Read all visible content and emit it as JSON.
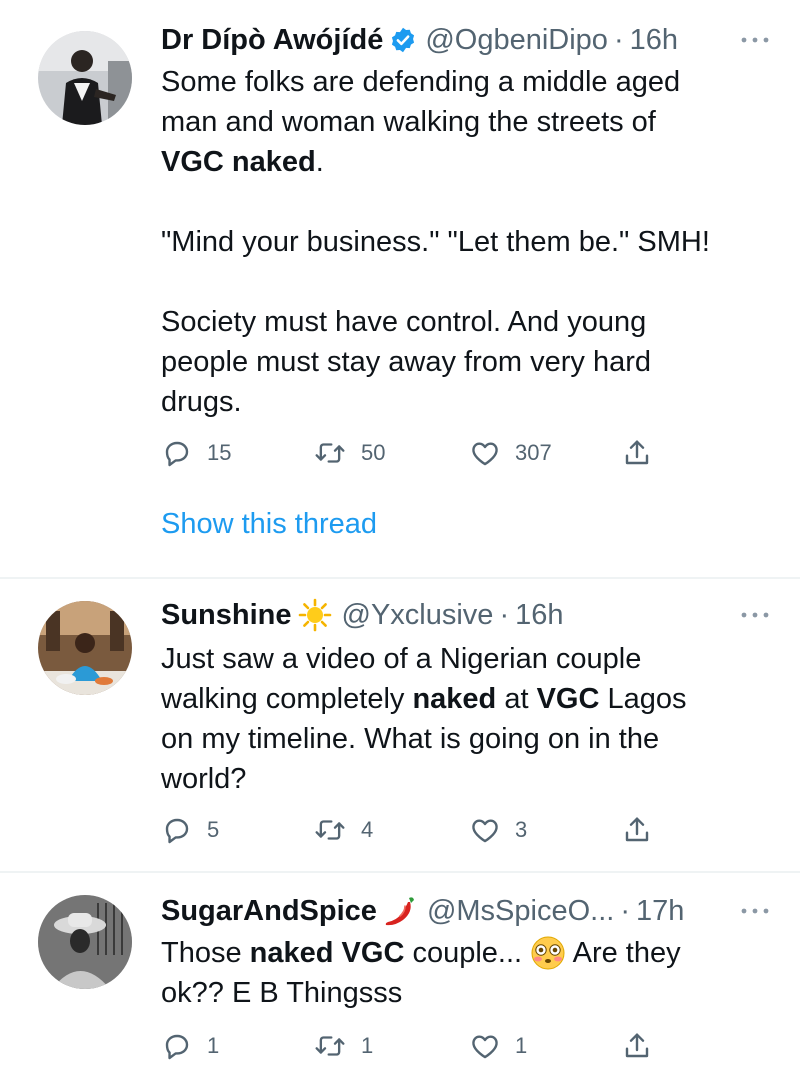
{
  "tweets": [
    {
      "display_name": "Dr Dípò Awójídé",
      "verified": true,
      "handle": "@OgbeniDipo",
      "time": "16h",
      "body": {
        "l1": "Some folks are defending a middle aged",
        "l2": "man and woman walking the streets of",
        "l3_bold": "VGC naked",
        "l3_end": ".",
        "l4": "\"Mind your business.\" \"Let them be.\" SMH!",
        "l5": "Society must have control. And young",
        "l6": "people must stay away from very hard",
        "l7": "drugs."
      },
      "replies": "15",
      "retweets": "50",
      "likes": "307",
      "show_thread": "Show this thread"
    },
    {
      "display_name": "Sunshine",
      "name_emoji": "sun-emoji",
      "handle": "@Yxclusive",
      "time": "16h",
      "body": {
        "l1": "Just saw a video of a Nigerian couple",
        "l2_a": "walking completely ",
        "l2_b": "naked",
        "l2_c": " at ",
        "l2_d": "VGC",
        "l2_e": " Lagos",
        "l3": "on my timeline. What is going on in the",
        "l4": "world?"
      },
      "replies": "5",
      "retweets": "4",
      "likes": "3"
    },
    {
      "display_name": "SugarAndSpice",
      "name_emoji": "hot-pepper-emoji",
      "handle": "@MsSpiceO...",
      "time": "17h",
      "body": {
        "l1_a": "Those ",
        "l1_b": "naked VGC",
        "l1_c": " couple... ",
        "l1_d": " Are they",
        "l2": "ok?? E B Thingsss"
      },
      "inline_emoji": "flushed-face-emoji",
      "replies": "1",
      "retweets": "1",
      "likes": "1"
    }
  ],
  "colors": {
    "primary_text": "#0f1419",
    "secondary_text": "#536471",
    "link_blue": "#1d9bf0",
    "verified_blue": "#1d9bf0",
    "divider": "#eff3f4"
  },
  "icons": [
    "reply-icon",
    "retweet-icon",
    "like-icon",
    "share-icon",
    "more-icon",
    "verified-badge-icon"
  ]
}
